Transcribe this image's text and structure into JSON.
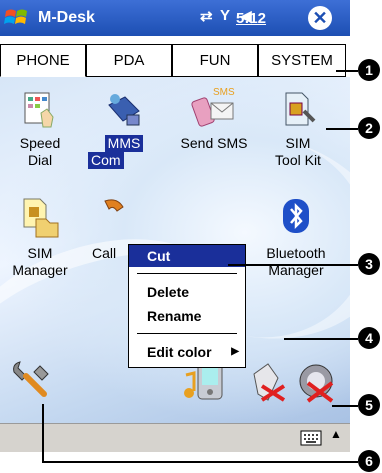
{
  "title_bar": {
    "app_title": "M-Desk",
    "clock": "5:12",
    "status_icons": [
      "connectivity-icon",
      "signal-off-icon",
      "volume-icon"
    ],
    "close_glyph": "✕"
  },
  "tabs": [
    {
      "label": "PHONE",
      "active": true
    },
    {
      "label": "PDA",
      "active": false
    },
    {
      "label": "FUN",
      "active": false
    },
    {
      "label": "SYSTEM",
      "active": false
    }
  ],
  "desktop_icons": [
    {
      "label_line1": "Speed",
      "label_line2": "Dial",
      "icon": "speed-dial-icon"
    },
    {
      "label_line1": "MMS",
      "label_line2": "Com",
      "icon": "mms-composer-icon",
      "selected": true
    },
    {
      "label_line1": "Send SMS",
      "label_line2": "",
      "icon": "send-sms-icon"
    },
    {
      "label_line1": "SIM",
      "label_line2": "Tool Kit",
      "icon": "sim-toolkit-icon"
    },
    {
      "label_line1": "SIM",
      "label_line2": "Manager",
      "icon": "sim-manager-icon"
    },
    {
      "label_line1": "Call",
      "label_line2": "",
      "icon": "call-icon"
    },
    {
      "label_line1": "Bluetooth",
      "label_line2": "Manager",
      "icon": "bluetooth-icon"
    }
  ],
  "context_menu": {
    "items": [
      "Cut",
      "Delete",
      "Rename",
      "Edit color"
    ],
    "highlighted": "Cut",
    "submenu_arrow": "▶"
  },
  "taskbar": {
    "keyboard_arrow": "▲"
  },
  "callouts": [
    "1",
    "2",
    "3",
    "4",
    "5",
    "6"
  ],
  "colors": {
    "title_bar": "#1d4fb3",
    "selection": "#1a2f9a",
    "taskbar": "#d6d3ce"
  }
}
